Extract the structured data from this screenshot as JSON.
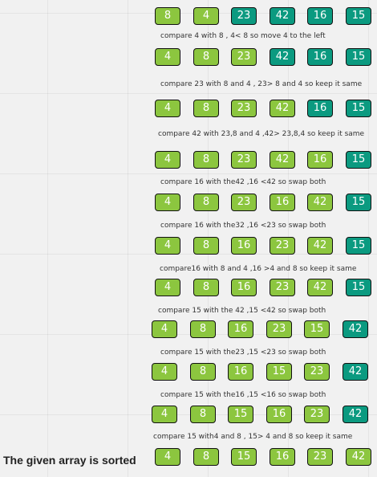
{
  "colors": {
    "lime": "#8cc63f",
    "teal": "#0b9a80",
    "outline": "#111111",
    "canvas": "#f1f1f1"
  },
  "steps": [
    {
      "values": [
        "8",
        "4",
        "23",
        "42",
        "16",
        "15"
      ],
      "colors": [
        "lime",
        "lime",
        "teal",
        "teal",
        "teal",
        "teal"
      ]
    },
    {
      "values": [
        "4",
        "8",
        "23",
        "42",
        "16",
        "15"
      ],
      "colors": [
        "lime",
        "lime",
        "lime",
        "teal",
        "teal",
        "teal"
      ]
    },
    {
      "values": [
        "4",
        "8",
        "23",
        "42",
        "16",
        "15"
      ],
      "colors": [
        "lime",
        "lime",
        "lime",
        "lime",
        "teal",
        "teal"
      ]
    },
    {
      "values": [
        "4",
        "8",
        "23",
        "42",
        "16",
        "15"
      ],
      "colors": [
        "lime",
        "lime",
        "lime",
        "lime",
        "lime",
        "teal"
      ]
    },
    {
      "values": [
        "4",
        "8",
        "23",
        "16",
        "42",
        "15"
      ],
      "colors": [
        "lime",
        "lime",
        "lime",
        "lime",
        "lime",
        "teal"
      ]
    },
    {
      "values": [
        "4",
        "8",
        "16",
        "23",
        "42",
        "15"
      ],
      "colors": [
        "lime",
        "lime",
        "lime",
        "lime",
        "lime",
        "teal"
      ]
    },
    {
      "values": [
        "4",
        "8",
        "16",
        "23",
        "42",
        "15"
      ],
      "colors": [
        "lime",
        "lime",
        "lime",
        "lime",
        "lime",
        "teal"
      ]
    },
    {
      "values": [
        "4",
        "8",
        "16",
        "23",
        "15",
        "42"
      ],
      "colors": [
        "lime",
        "lime",
        "lime",
        "lime",
        "lime",
        "teal"
      ]
    },
    {
      "values": [
        "4",
        "8",
        "16",
        "15",
        "23",
        "42"
      ],
      "colors": [
        "lime",
        "lime",
        "lime",
        "lime",
        "lime",
        "teal"
      ]
    },
    {
      "values": [
        "4",
        "8",
        "15",
        "16",
        "23",
        "42"
      ],
      "colors": [
        "lime",
        "lime",
        "lime",
        "lime",
        "lime",
        "teal"
      ]
    },
    {
      "values": [
        "4",
        "8",
        "15",
        "16",
        "23",
        "42"
      ],
      "colors": [
        "lime",
        "lime",
        "lime",
        "lime",
        "lime",
        "lime"
      ]
    }
  ],
  "captions": [
    "compare 4 with 8 , 4< 8 so move 4 to the left",
    "compare 23 with 8 and 4 , 23> 8 and 4 so keep it same",
    "compare 42 with 23,8 and 4 ,42> 23,8,4 so keep it same",
    "compare 16 with the42 ,16 <42 so swap both",
    "compare 16 with the32 ,16 <23 so swap both",
    "compare16 with 8 and 4 ,16 >4 and 8 so keep it same",
    "compare 15 with the 42 ,15 <42 so swap both",
    "compare 15 with the23 ,15 <23  so swap both",
    "compare 15 with the16 ,15 <16  so swap both",
    "compare 15 with4 and 8 , 15> 4 and 8 so keep it same"
  ],
  "conclusion": "The given array is sorted"
}
